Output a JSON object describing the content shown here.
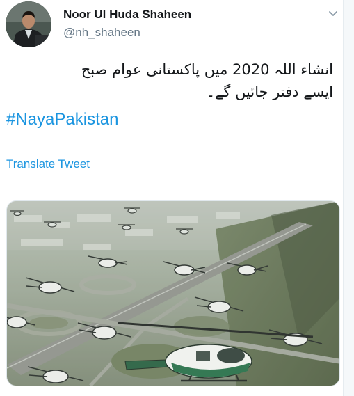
{
  "tweet": {
    "author_name": "Noor Ul Huda Shaheen",
    "author_handle": "@nh_shaheen",
    "text_line1": "انشاء اللہ 2020 میں پاکستانی عوام صبح",
    "text_line2": "ایسے دفتر جائیں گے۔",
    "hashtag": "#NayaPakistan",
    "translate_label": "Translate Tweet",
    "menu_icon": "chevron-down-icon",
    "media_description_icon": "photo"
  },
  "colors": {
    "link": "#1b95e0",
    "text_primary": "#14171a",
    "text_secondary": "#657786"
  }
}
